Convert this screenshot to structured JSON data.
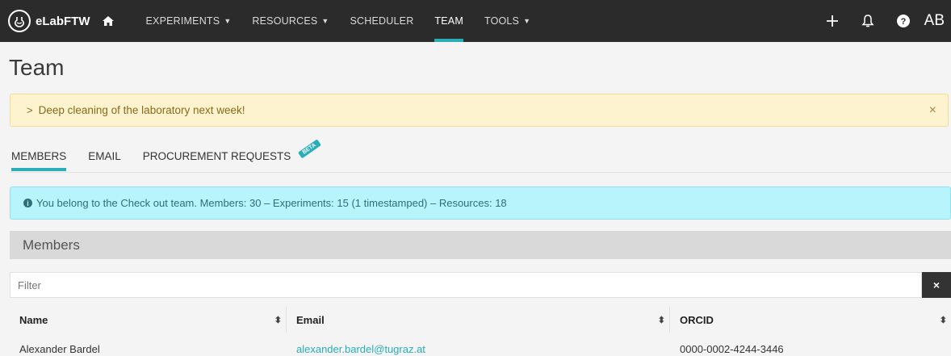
{
  "navbar": {
    "brand": "eLabFTW",
    "items": [
      {
        "label": "EXPERIMENTS",
        "dropdown": true
      },
      {
        "label": "RESOURCES",
        "dropdown": true
      },
      {
        "label": "SCHEDULER",
        "dropdown": false
      },
      {
        "label": "TEAM",
        "dropdown": false,
        "active": true
      },
      {
        "label": "TOOLS",
        "dropdown": true
      }
    ],
    "user_initials": "AB",
    "icons": [
      "plus-icon",
      "bell-icon",
      "help-icon"
    ]
  },
  "page": {
    "title": "Team"
  },
  "banner": {
    "message": "Deep cleaning of the laboratory next week!",
    "close": "×"
  },
  "tabs": {
    "items": [
      "MEMBERS",
      "EMAIL",
      "PROCUREMENT REQUESTS"
    ],
    "active": "MEMBERS",
    "beta": "BETA"
  },
  "info": {
    "text": "You belong to the Check out team. Members: 30 – Experiments: 15 (1 timestamped) – Resources: 18"
  },
  "members": {
    "title": "Members",
    "filter_placeholder": "Filter",
    "clear": "×",
    "columns": [
      "Name",
      "Email",
      "ORCID"
    ],
    "rows": [
      {
        "name": "Alexander Bardel",
        "email": "alexander.bardel@tugraz.at",
        "orcid": "0000-0002-4244-3446"
      }
    ]
  },
  "colors": {
    "navbar": "#2b2b2b",
    "accent": "#29aeb9",
    "banner": "#fdf3cf",
    "info": "#b8f4fb"
  }
}
